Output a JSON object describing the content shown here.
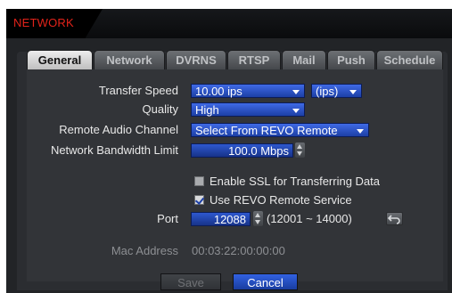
{
  "window": {
    "title": "NETWORK"
  },
  "tabs": [
    {
      "label": "General",
      "active": true
    },
    {
      "label": "Network",
      "active": false
    },
    {
      "label": "DVRNS",
      "active": false
    },
    {
      "label": "RTSP",
      "active": false
    },
    {
      "label": "Mail",
      "active": false
    },
    {
      "label": "Push",
      "active": false
    },
    {
      "label": "Schedule",
      "active": false
    }
  ],
  "general": {
    "transfer_speed": {
      "label": "Transfer Speed",
      "value": "10.00 ips",
      "unit": "(ips)"
    },
    "quality": {
      "label": "Quality",
      "value": "High"
    },
    "remote_audio": {
      "label": "Remote Audio Channel",
      "value": "Select From REVO Remote"
    },
    "bandwidth": {
      "label": "Network Bandwidth Limit",
      "value": "100.0 Mbps"
    },
    "enable_ssl": {
      "label": "Enable SSL for Transferring Data",
      "checked": false
    },
    "use_revo": {
      "label": "Use REVO Remote Service",
      "checked": true
    },
    "port": {
      "label": "Port",
      "value": "12088",
      "range": "(12001 ~ 14000)"
    },
    "mac": {
      "label": "Mac Address",
      "value": "00:03:22:00:00:00"
    }
  },
  "buttons": {
    "save": "Save",
    "cancel": "Cancel"
  },
  "colors": {
    "title_red": "#e2231a",
    "field_blue": "#1c3fa6",
    "panel": "#323438"
  },
  "icons": [
    "dropdown-arrow-icon",
    "spinner-icon",
    "checkmark-icon",
    "reset-arrow-icon"
  ]
}
